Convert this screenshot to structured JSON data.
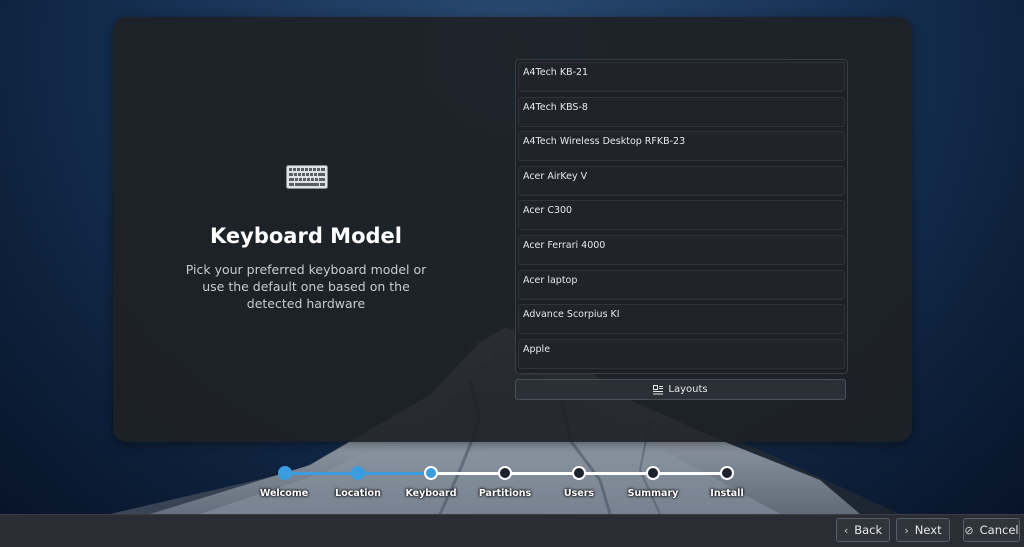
{
  "left_pane": {
    "icon": "keyboard-icon",
    "title": "Keyboard Model",
    "subtitle": "Pick your preferred keyboard model or use the default one based on the detected hardware"
  },
  "model_list": {
    "items": [
      "A4Tech KB-21",
      "A4Tech KBS-8",
      "A4Tech Wireless Desktop RFKB-23",
      "Acer AirKey V",
      "Acer C300",
      "Acer Ferrari 4000",
      "Acer laptop",
      "Advance Scorpius KI",
      "Apple"
    ]
  },
  "layouts_button": {
    "label": "Layouts",
    "icon": "layouts-icon"
  },
  "steps": [
    {
      "label": "Welcome",
      "state": "done"
    },
    {
      "label": "Location",
      "state": "done"
    },
    {
      "label": "Keyboard",
      "state": "current"
    },
    {
      "label": "Partitions",
      "state": "todo"
    },
    {
      "label": "Users",
      "state": "todo"
    },
    {
      "label": "Summary",
      "state": "todo"
    },
    {
      "label": "Install",
      "state": "todo"
    }
  ],
  "nav": {
    "back_label": "Back",
    "next_label": "Next",
    "cancel_label": "Cancel"
  },
  "colors": {
    "accent": "#3b9de0",
    "card_bg": "#1e2126",
    "text": "#ffffff"
  }
}
